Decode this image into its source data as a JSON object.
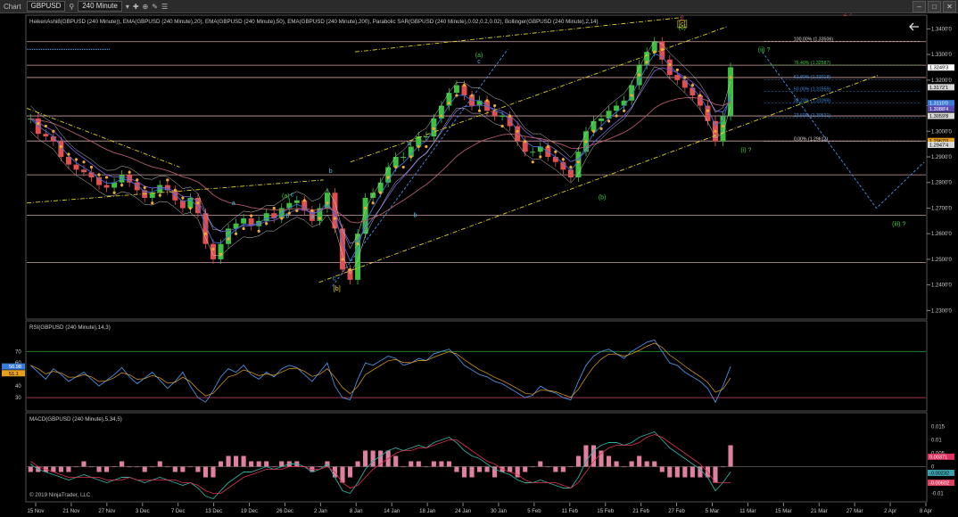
{
  "toolbar": {
    "app_label": "Chart",
    "symbol": "GBPUSD",
    "interval": "240 Minute",
    "icons": [
      "search-icon",
      "chevron-down-icon",
      "crosshair-icon",
      "zoom-icon",
      "draw-icon",
      "properties-icon",
      "minimize-icon",
      "maximize-icon",
      "close-icon"
    ]
  },
  "colors": {
    "background": "#000000",
    "panel_border": "#555555",
    "bull_candle": "#3fbf3f",
    "bear_candle": "#e05050",
    "ema20": "#3b6fd8",
    "ema50": "#6a5cc8",
    "ema200": "#b25a6a",
    "sar": "#f0a830",
    "bollinger": "#cccccc",
    "channel": "#e0d020",
    "wave_blue": "#4a90e0",
    "fib_line": "#d0a0a0",
    "label_green": "#3ccf3c",
    "label_cyan": "#40c0e0",
    "label_yellow": "#e6d23c",
    "label_red": "#e03030"
  },
  "chart_data": [
    {
      "type": "candlestick",
      "title": "HeikenAshi8(GBPUSD (240 Minute)), EMA(GBPUSD (240 Minute),20), EMA(GBPUSD (240 Minute),50), EMA(GBPUSD (240 Minute),200), Parabolic SAR(GBPUSD (240 Minute),0.02,0.2,0.02), Bollinger(GBPUSD (240 Minute),2,14)",
      "x_ticks": [
        "15 Nov",
        "21 Nov",
        "27 Nov",
        "3 Dec",
        "7 Dec",
        "13 Dec",
        "19 Dec",
        "26 Dec",
        "2 Jan",
        "8 Jan",
        "14 Jan",
        "18 Jan",
        "24 Jan",
        "30 Jan",
        "5 Feb",
        "11 Feb",
        "15 Feb",
        "21 Feb",
        "27 Feb",
        "5 Mar",
        "11 Mar",
        "15 Mar",
        "21 Mar",
        "27 Mar",
        "2 Apr",
        "8 Apr"
      ],
      "y_ticks": [
        "1.2300'0",
        "1.2400'0",
        "1.2500'0",
        "1.2600'0",
        "1.2700'0",
        "1.2800'0",
        "1.2900'0",
        "1.3000'0",
        "1.3100'0",
        "1.3200'0",
        "1.3300'0",
        "1.3400'0"
      ],
      "ylim": [
        1.227,
        1.345
      ],
      "price_tags": [
        {
          "text": "1.3249'3",
          "bg": "#ffffff",
          "fg": "#000000",
          "value": 1.3249
        },
        {
          "text": "1.3172'1",
          "bg": "#d8d8d8",
          "fg": "#000000",
          "value": 1.3172
        },
        {
          "text": "1.3110'0",
          "bg": "#3a7ad8",
          "fg": "#ffffff",
          "value": 1.311
        },
        {
          "text": "1.3088'4",
          "bg": "#5a4ab0",
          "fg": "#ffffff",
          "value": 1.3088
        },
        {
          "text": "1.3059'8",
          "bg": "#d8d8d8",
          "fg": "#000000",
          "value": 1.306
        },
        {
          "text": "1.2962'0",
          "bg": "#e6a020",
          "fg": "#000000",
          "value": 1.2962
        },
        {
          "text": "1.2947'4",
          "bg": "#d8d8d8",
          "fg": "#000000",
          "value": 1.2947
        }
      ],
      "horizontal_levels": [
        1.335,
        1.3258,
        1.321,
        1.306,
        1.2962,
        1.283,
        1.2672,
        1.2488
      ],
      "fib_levels": [
        {
          "label": "100.00% (1.33506)",
          "value": 1.3351,
          "color": "#dddddd"
        },
        {
          "label": "76.40% (1.32587)",
          "value": 1.3259,
          "color": "#3ccf3c"
        },
        {
          "label": "61.80% (1.32018)",
          "value": 1.3202,
          "color": "#3b8fe0"
        },
        {
          "label": "50.00% (1.31559)",
          "value": 1.3156,
          "color": "#3b8fe0"
        },
        {
          "label": "38.20% (1.31099)",
          "value": 1.311,
          "color": "#3b8fe0"
        },
        {
          "label": "23.60% (1.30531)",
          "value": 1.3053,
          "color": "#3b8fe0"
        },
        {
          "label": "0.00% (1.29612)",
          "value": 1.2961,
          "color": "#dddddd"
        }
      ],
      "wave_labels": [
        {
          "text": "[b]",
          "x": 0.345,
          "y": 1.2378,
          "color": "#e6d23c"
        },
        {
          "text": "c",
          "x": 0.342,
          "y": 1.2418,
          "color": "#40c0e0"
        },
        {
          "text": "(a)",
          "x": 0.288,
          "y": 1.274,
          "color": "#3ccf3c"
        },
        {
          "text": "(a)",
          "x": 0.503,
          "y": 1.329,
          "color": "#3ccf3c"
        },
        {
          "text": "c",
          "x": 0.503,
          "y": 1.3265,
          "color": "#40c0e0"
        },
        {
          "text": "(b)",
          "x": 0.64,
          "y": 1.2735,
          "color": "#3ccf3c"
        },
        {
          "text": "(c)",
          "x": 0.729,
          "y": 1.3398,
          "color": "#3ccf3c"
        },
        {
          "text": "[c]",
          "x": 0.729,
          "y": 1.3412,
          "color": "#e6d23c"
        },
        {
          "text": "2",
          "x": 0.729,
          "y": 1.3435,
          "color": "#e03030"
        },
        {
          "text": "2 ?",
          "x": 0.913,
          "y": 1.345,
          "color": "#e03030"
        },
        {
          "text": "(ii) ?",
          "x": 0.82,
          "y": 1.331,
          "color": "#3ccf3c"
        },
        {
          "text": "(i) ?",
          "x": 0.8,
          "y": 1.292,
          "color": "#3ccf3c"
        },
        {
          "text": "(iii) ?",
          "x": 0.97,
          "y": 1.263,
          "color": "#3ccf3c"
        },
        {
          "text": "a",
          "x": 0.23,
          "y": 1.2712,
          "color": "#40c0e0"
        },
        {
          "text": "b",
          "x": 0.29,
          "y": 1.2662,
          "color": "#40c0e0"
        },
        {
          "text": "c",
          "x": 0.295,
          "y": 1.2745,
          "color": "#40c0e0"
        },
        {
          "text": "a",
          "x": 0.318,
          "y": 1.266,
          "color": "#40c0e0"
        },
        {
          "text": "b",
          "x": 0.338,
          "y": 1.2838,
          "color": "#40c0e0"
        },
        {
          "text": "a",
          "x": 0.425,
          "y": 1.2945,
          "color": "#40c0e0"
        },
        {
          "text": "b",
          "x": 0.432,
          "y": 1.2665,
          "color": "#40c0e0"
        }
      ],
      "close_series": [
        1.305,
        1.299,
        1.298,
        1.296,
        1.29,
        1.287,
        1.285,
        1.284,
        1.282,
        1.279,
        1.278,
        1.28,
        1.283,
        1.28,
        1.277,
        1.274,
        1.276,
        1.279,
        1.277,
        1.273,
        1.27,
        1.274,
        1.268,
        1.256,
        1.25,
        1.256,
        1.262,
        1.264,
        1.266,
        1.263,
        1.265,
        1.268,
        1.266,
        1.27,
        1.272,
        1.273,
        1.269,
        1.265,
        1.27,
        1.276,
        1.262,
        1.246,
        1.242,
        1.26,
        1.274,
        1.276,
        1.28,
        1.286,
        1.29,
        1.29,
        1.294,
        1.298,
        1.298,
        1.305,
        1.31,
        1.315,
        1.318,
        1.314,
        1.31,
        1.312,
        1.308,
        1.306,
        1.306,
        1.302,
        1.296,
        1.292,
        1.292,
        1.294,
        1.29,
        1.288,
        1.285,
        1.282,
        1.292,
        1.3,
        1.304,
        1.305,
        1.308,
        1.31,
        1.312,
        1.318,
        1.326,
        1.331,
        1.335,
        1.328,
        1.322,
        1.32,
        1.317,
        1.314,
        1.31,
        1.304,
        1.296,
        1.306,
        1.325
      ]
    },
    {
      "type": "line",
      "title": "RSI(GBPUSD (240 Minute),14,3)",
      "y_ticks": [
        "30",
        "40",
        "50",
        "60",
        "70"
      ],
      "ylim": [
        20,
        88
      ],
      "levels": [
        70,
        30
      ],
      "value_tags": [
        {
          "text": "56.98",
          "bg": "#3a7ad8",
          "fg": "#ffffff",
          "value": 56.98
        },
        {
          "text": "51.1",
          "bg": "#e6a020",
          "fg": "#000000",
          "value": 51.1
        }
      ],
      "values": [
        58,
        52,
        46,
        55,
        50,
        44,
        48,
        52,
        46,
        40,
        45,
        50,
        56,
        48,
        42,
        47,
        52,
        45,
        38,
        44,
        52,
        40,
        30,
        26,
        36,
        48,
        55,
        52,
        58,
        50,
        46,
        52,
        48,
        55,
        58,
        56,
        50,
        44,
        52,
        60,
        40,
        30,
        28,
        46,
        60,
        58,
        62,
        66,
        64,
        58,
        60,
        64,
        62,
        68,
        70,
        72,
        66,
        58,
        54,
        50,
        48,
        44,
        42,
        38,
        34,
        30,
        32,
        40,
        36,
        34,
        30,
        28,
        44,
        58,
        66,
        70,
        72,
        68,
        64,
        70,
        74,
        78,
        80,
        70,
        60,
        58,
        52,
        48,
        44,
        38,
        26,
        40,
        56.98
      ]
    },
    {
      "type": "line",
      "title": "MACD(GBPUSD (240 Minute),5,34,5)",
      "y_ticks": [
        "-0.01",
        "0",
        "0.005",
        "0.01",
        "0.015"
      ],
      "ylim": [
        -0.0125,
        0.0165
      ],
      "value_tags": [
        {
          "text": "0.00371",
          "bg": "#e03060",
          "fg": "#ffffff",
          "value": 0.00371
        },
        {
          "text": "-0.00232",
          "bg": "#3aa0b0",
          "fg": "#000000",
          "value": -0.00232
        },
        {
          "text": "-0.00602",
          "bg": "#e04060",
          "fg": "#ffffff",
          "value": -0.00602
        }
      ],
      "macd": [
        0.001,
        -0.001,
        -0.002,
        -0.003,
        -0.004,
        -0.005,
        -0.004,
        -0.003,
        -0.004,
        -0.005,
        -0.006,
        -0.005,
        -0.004,
        -0.004,
        -0.005,
        -0.006,
        -0.005,
        -0.004,
        -0.005,
        -0.006,
        -0.007,
        -0.006,
        -0.008,
        -0.011,
        -0.012,
        -0.009,
        -0.006,
        -0.004,
        -0.002,
        -0.002,
        -0.001,
        0.0,
        -0.001,
        0.0,
        0.001,
        0.001,
        0.0,
        -0.002,
        -0.001,
        0.001,
        -0.004,
        -0.009,
        -0.01,
        -0.006,
        -0.001,
        0.002,
        0.004,
        0.006,
        0.007,
        0.006,
        0.007,
        0.008,
        0.007,
        0.009,
        0.01,
        0.011,
        0.009,
        0.006,
        0.004,
        0.003,
        0.001,
        -0.001,
        -0.002,
        -0.003,
        -0.005,
        -0.006,
        -0.006,
        -0.005,
        -0.006,
        -0.007,
        -0.008,
        -0.008,
        -0.004,
        0.002,
        0.006,
        0.008,
        0.009,
        0.009,
        0.008,
        0.009,
        0.011,
        0.012,
        0.013,
        0.01,
        0.007,
        0.005,
        0.003,
        0.001,
        -0.001,
        -0.004,
        -0.009,
        -0.006,
        -0.002
      ],
      "signal": [
        0.002,
        0.0,
        -0.001,
        -0.002,
        -0.003,
        -0.004,
        -0.004,
        -0.004,
        -0.004,
        -0.004,
        -0.005,
        -0.005,
        -0.005,
        -0.004,
        -0.005,
        -0.005,
        -0.005,
        -0.005,
        -0.005,
        -0.005,
        -0.006,
        -0.006,
        -0.007,
        -0.009,
        -0.01,
        -0.01,
        -0.008,
        -0.006,
        -0.004,
        -0.003,
        -0.002,
        -0.001,
        -0.001,
        -0.001,
        0.0,
        0.0,
        0.0,
        -0.001,
        -0.001,
        0.0,
        -0.002,
        -0.006,
        -0.008,
        -0.007,
        -0.004,
        -0.001,
        0.001,
        0.003,
        0.005,
        0.006,
        0.006,
        0.007,
        0.007,
        0.008,
        0.009,
        0.01,
        0.01,
        0.008,
        0.006,
        0.004,
        0.002,
        0.001,
        -0.001,
        -0.002,
        -0.003,
        -0.005,
        -0.006,
        -0.006,
        -0.006,
        -0.006,
        -0.007,
        -0.008,
        -0.006,
        -0.002,
        0.002,
        0.005,
        0.007,
        0.008,
        0.008,
        0.008,
        0.009,
        0.011,
        0.012,
        0.011,
        0.009,
        0.007,
        0.005,
        0.003,
        0.001,
        -0.002,
        -0.006,
        -0.006,
        -0.006
      ]
    }
  ],
  "copyright": "© 2019 NinjaTrader, LLC"
}
